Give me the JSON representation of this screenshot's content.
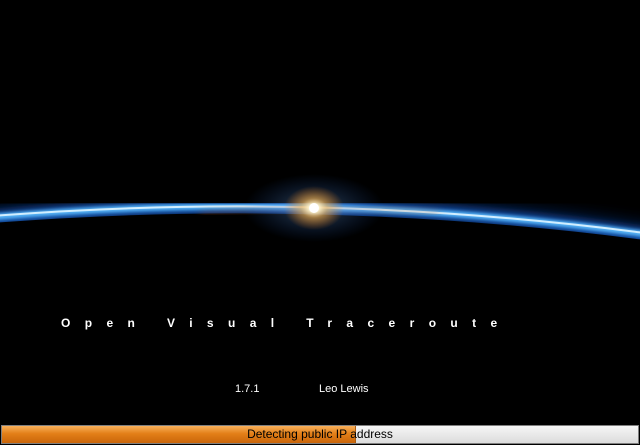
{
  "splash": {
    "title": "Open Visual Traceroute",
    "version": "1.7.1",
    "author": "Leo Lewis",
    "background_image": "earth-horizon-sunrise",
    "colors": {
      "background": "#000000",
      "atmosphere_glow": "#3fa7ff",
      "sun_glow": "#ffb347",
      "progress_fill": "#e37f18"
    }
  },
  "progress": {
    "status": "Detecting public IP address",
    "fraction": 0.555
  }
}
